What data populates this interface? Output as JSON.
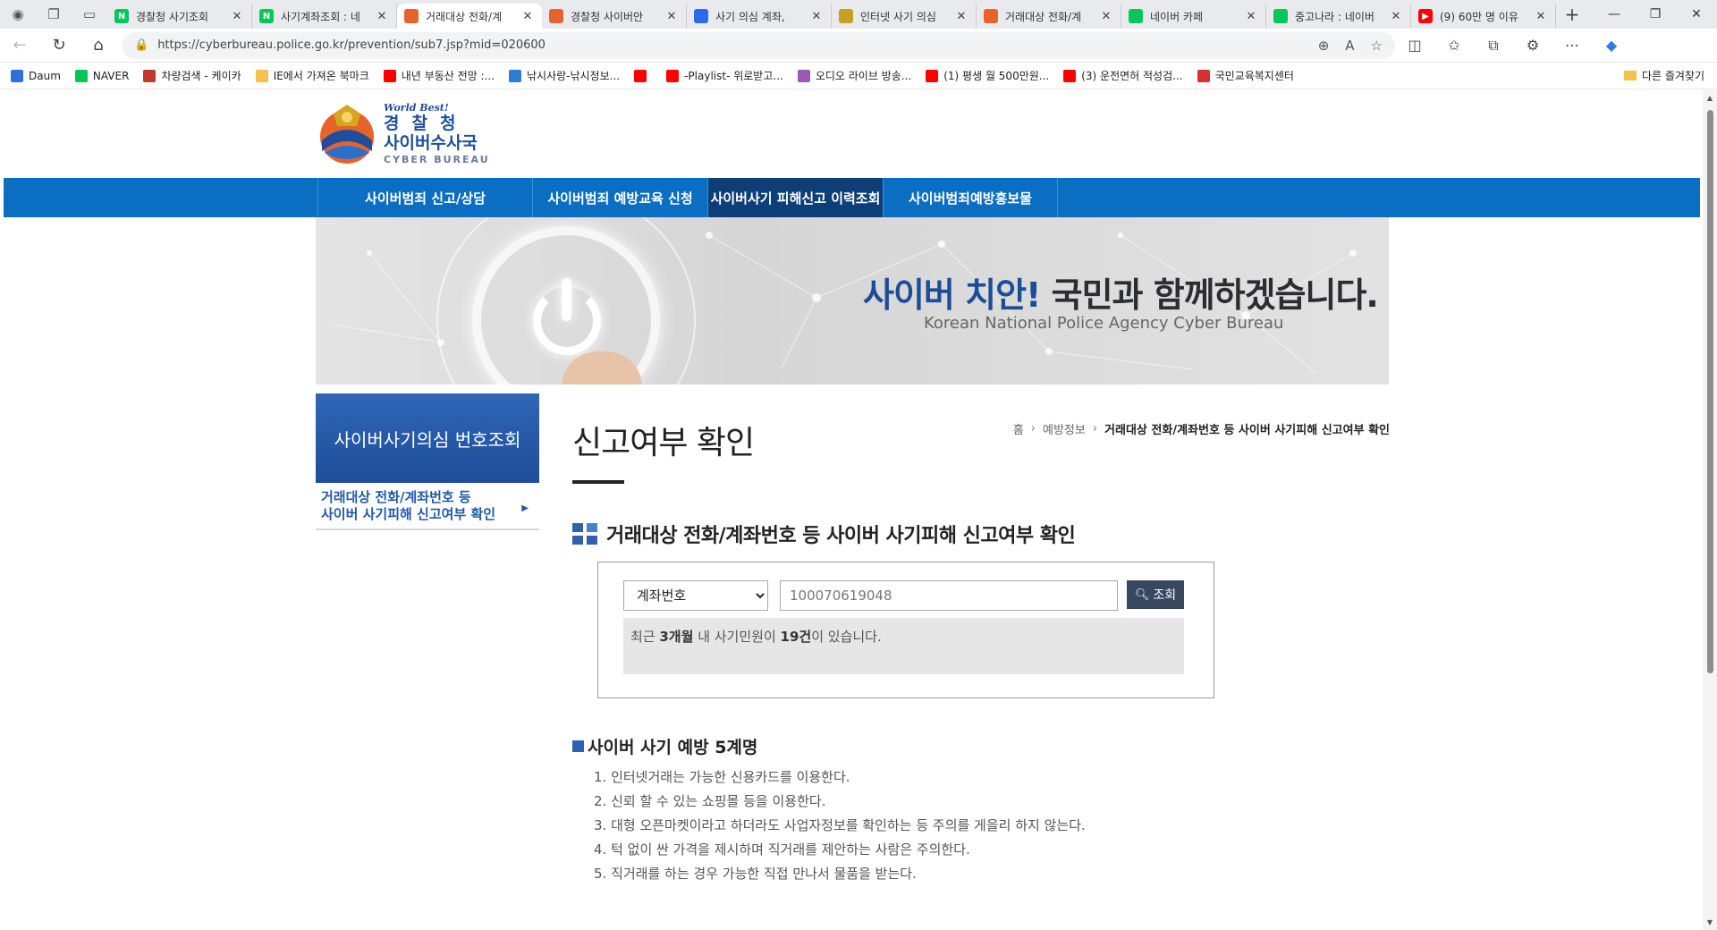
{
  "browser": {
    "tabs": [
      {
        "title": "경찰청 사기조회",
        "fav_color": "#03c75a",
        "fav_glyph": "N",
        "active": false
      },
      {
        "title": "사기계좌조회 : 네",
        "fav_color": "#03c75a",
        "fav_glyph": "N",
        "active": false
      },
      {
        "title": "거래대상 전화/계",
        "fav_color": "#e8632b",
        "fav_glyph": "",
        "active": true
      },
      {
        "title": "경찰청 사이버안",
        "fav_color": "#e8632b",
        "fav_glyph": "",
        "active": false
      },
      {
        "title": "사기 의심 계좌,",
        "fav_color": "#2b6be8",
        "fav_glyph": "",
        "active": false
      },
      {
        "title": "인터넷 사기 의심",
        "fav_color": "#c8a020",
        "fav_glyph": "",
        "active": false
      },
      {
        "title": "거래대상 전화/계",
        "fav_color": "#e8632b",
        "fav_glyph": "",
        "active": false
      },
      {
        "title": "네이버 카페",
        "fav_color": "#03c75a",
        "fav_glyph": "",
        "active": false
      },
      {
        "title": "중고나라 : 네이버",
        "fav_color": "#03c75a",
        "fav_glyph": "",
        "active": false
      },
      {
        "title": "(9) 60만 명 이유",
        "fav_color": "#ff0000",
        "fav_glyph": "▶",
        "active": false
      }
    ],
    "url": "https://cyberbureau.police.go.kr/prevention/sub7.jsp?mid=020600",
    "bookmarks": [
      {
        "label": "Daum",
        "color": "#2f6fde"
      },
      {
        "label": "NAVER",
        "color": "#03c75a"
      },
      {
        "label": "차량검색 - 케이카",
        "color": "#c0392b"
      },
      {
        "label": "IE에서 가져온 북마크",
        "color": "#f2c14e"
      },
      {
        "label": "내년 부동산 전망 :...",
        "color": "#ff0000"
      },
      {
        "label": "낚시사랑-낚시정보...",
        "color": "#2a7fd4"
      },
      {
        "label": "",
        "color": "#ff0000"
      },
      {
        "label": "-Playlist- 위로받고...",
        "color": "#ff0000"
      },
      {
        "label": "오디오 라이브 방송...",
        "color": "#9b59b6"
      },
      {
        "label": "(1) 평생 월 500만원...",
        "color": "#ff0000"
      },
      {
        "label": "(3) 운전면허 적성검...",
        "color": "#ff0000"
      },
      {
        "label": "국민교육복지센터",
        "color": "#d63031"
      }
    ],
    "other_bookmarks": "다른 즐겨찾기"
  },
  "site": {
    "logo": {
      "world_best": "World Best!",
      "org": "경찰청",
      "bureau": "사이버수사국",
      "english": "CYBER BUREAU"
    },
    "gnb": [
      {
        "label": "사이버범죄 신고/상담",
        "active": false
      },
      {
        "label": "사이버범죄 예방교육 신청",
        "active": false
      },
      {
        "label": "사이버사기 피해신고 이력조회",
        "active": true
      },
      {
        "label": "사이버범죄예방홍보물",
        "active": false
      }
    ],
    "banner": {
      "slogan_highlight": "사이버 치안!",
      "slogan_rest": " 국민과 함께하겠습니다.",
      "subtitle": "Korean National Police Agency Cyber Bureau"
    },
    "lnb": {
      "head": "사이버사기의심 번호조회",
      "item_line1": "거래대상 전화/계좌번호 등",
      "item_line2": "사이버 사기피해 신고여부 확인"
    },
    "page_title": "신고여부 확인",
    "breadcrumb": [
      "홈",
      "예방정보",
      "거래대상 전화/계좌번호 등 사이버 사기피해 신고여부 확인"
    ],
    "section_title": "거래대상 전화/계좌번호 등 사이버 사기피해 신고여부 확인",
    "search": {
      "type_selected": "계좌번호",
      "number_value": "100070619048",
      "button_label": "조회",
      "result_prefix": "최근 ",
      "result_period": "3개월",
      "result_mid": " 내 사기민원이 ",
      "result_count": "19건",
      "result_suffix": "이 있습니다."
    },
    "tips": {
      "title": "사이버 사기 예방 5계명",
      "items": [
        "1. 인터넷거래는 가능한 신용카드를 이용한다.",
        "2. 신뢰 할 수 있는 쇼핑몰 등을 이용한다.",
        "3. 대형 오픈마켓이라고 하더라도 사업자정보를 확인하는 등 주의를 게을리 하지 않는다.",
        "4. 턱 없이 싼 가격을 제시하며 직거래를 제안하는 사람은 주의한다.",
        "5. 직거래를 하는 경우 가능한 직접 만나서 물품을 받는다."
      ]
    }
  }
}
